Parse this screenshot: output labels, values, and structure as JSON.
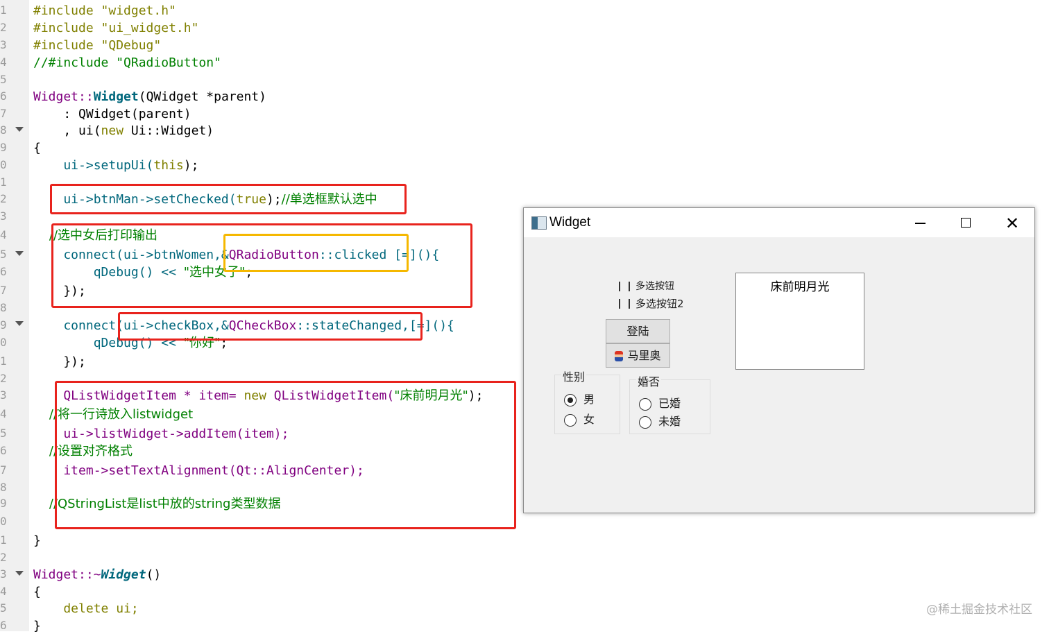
{
  "editor": {
    "line_numbers": [
      "1",
      "2",
      "3",
      "4",
      "5",
      "6",
      "7",
      "8",
      "9",
      "0",
      "1",
      "2",
      "3",
      "4",
      "5",
      "6",
      "7",
      "8",
      "9",
      "0",
      "1",
      "2",
      "3",
      "4",
      "5",
      "6",
      "7",
      "8",
      "9",
      "0",
      "1",
      "2",
      "3",
      "4",
      "5",
      "6"
    ]
  },
  "code": {
    "l1": "#include \"widget.h\"",
    "l2": "#include \"ui_widget.h\"",
    "l3": "#include \"QDebug\"",
    "l4": "//#include \"QRadioButton\"",
    "l6a": "Widget::",
    "l6b": "Widget",
    "l6c": "(QWidget *parent)",
    "l7": "    : QWidget(parent)",
    "l8a": "    , ui(",
    "l8b": "new",
    "l8c": " Ui::Widget)",
    "l9": "{",
    "l10a": "    ui->setupUi(",
    "l10b": "this",
    "l10c": ");",
    "l12a": "    ui->btnMan->setChecked(",
    "l12b": "true",
    "l12c": ");",
    "l12d": "//单选框默认选中",
    "l14": "    //选中女后打印输出",
    "l15a": "    connect(ui->btnWomen,&",
    "l15b": "QRadioButton",
    "l15c": "::clicked [=](){",
    "l16a": "        qDebug() << ",
    "l16b": "\"选中女子\"",
    "l16c": ";",
    "l17": "    });",
    "l19a": "    connect(ui->checkBox,&",
    "l19b": "QCheckBox",
    "l19c": "::stateChanged,[=](){",
    "l20a": "        qDebug() << ",
    "l20b": "\"你好\"",
    "l20c": ";",
    "l21": "    });",
    "l23a": "    QListWidgetItem * item= ",
    "l23b": "new",
    "l23c": " QListWidgetItem(",
    "l23d": "\"床前明月光\"",
    "l23e": ");",
    "l24": "    //将一行诗放入listwidget",
    "l25": "    ui->listWidget->addItem(item);",
    "l26": "    //设置对齐格式",
    "l27": "    item->setTextAlignment(Qt::AlignCenter);",
    "l29": "    //QStringList是list中放的string类型数据",
    "l31": "}",
    "l33a": "Widget::~",
    "l33b": "Widget",
    "l33c": "()",
    "l34": "{",
    "l35": "    delete ui;",
    "l36": "}"
  },
  "window": {
    "title": "Widget",
    "checkbox1": "多选按钮",
    "checkbox2": "多选按钮2",
    "login_button": "登陆",
    "mario_button": "马里奥",
    "gender_group": "性别",
    "radio_male": "男",
    "radio_female": "女",
    "marriage_group": "婚否",
    "radio_married": "已婚",
    "radio_unmarried": "未婚",
    "list_item": "床前明月光"
  },
  "watermark": "@稀土掘金技术社区"
}
